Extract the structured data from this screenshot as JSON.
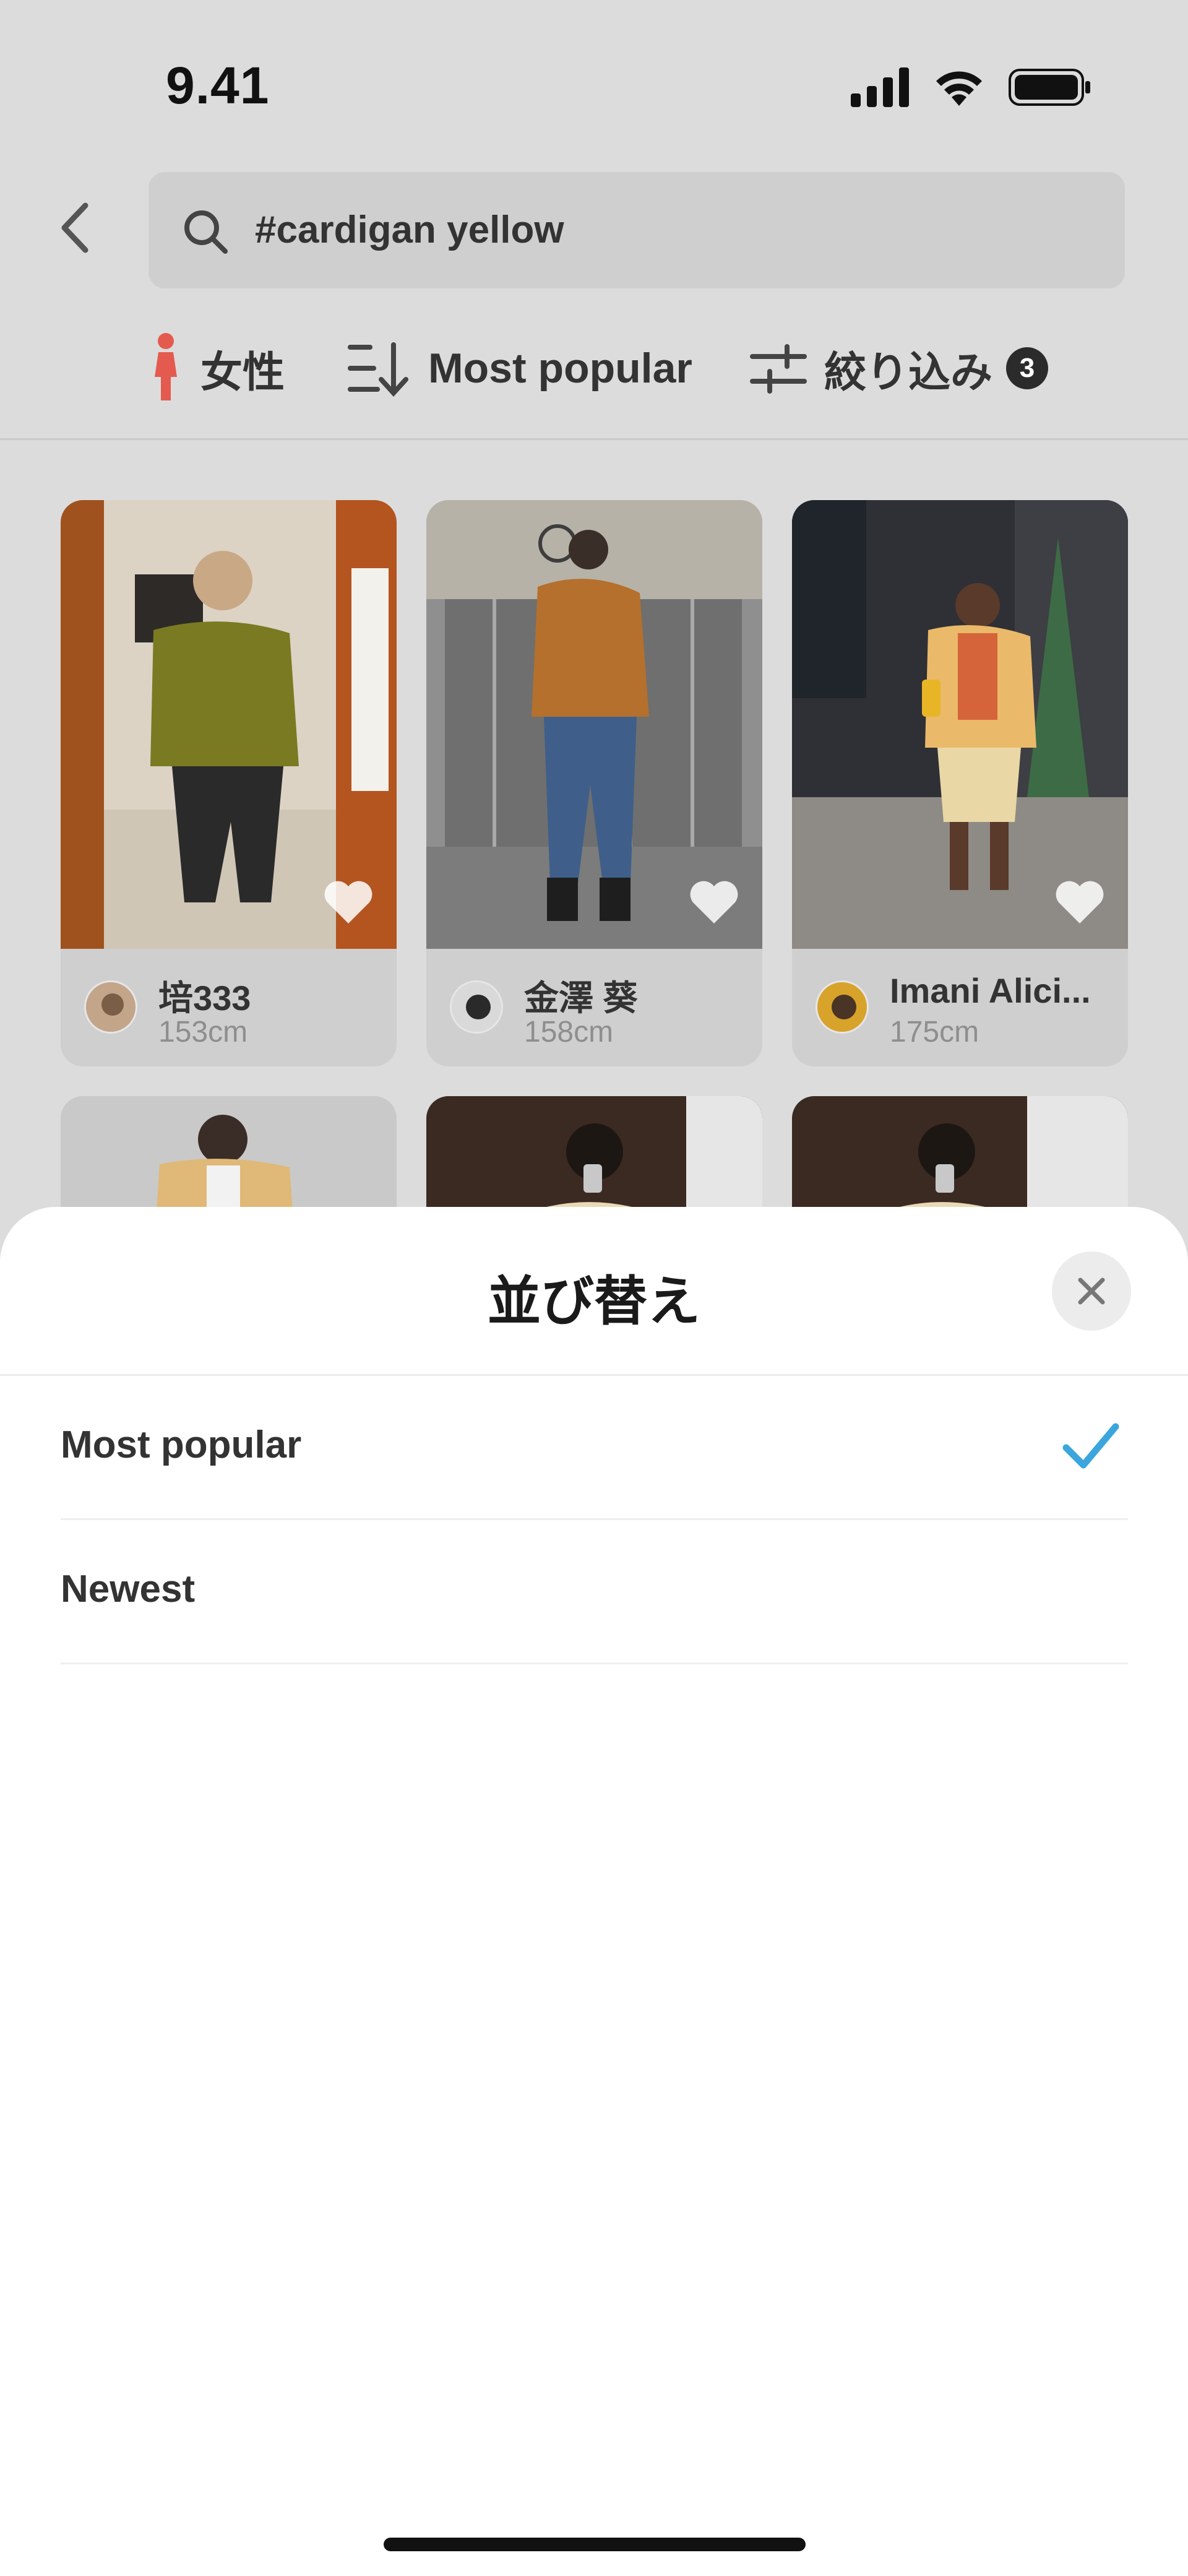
{
  "status_bar": {
    "time": "9.41"
  },
  "search": {
    "query": "#cardigan yellow"
  },
  "filters": {
    "gender_label": "女性",
    "sort_label": "Most popular",
    "refine_label": "絞り込み",
    "refine_count": "3"
  },
  "posts": [
    {
      "name": "培333",
      "height": "153cm"
    },
    {
      "name": "金澤 葵",
      "height": "158cm"
    },
    {
      "name": "Imani Alici...",
      "height": "175cm"
    }
  ],
  "sort_sheet": {
    "title": "並び替え",
    "options": [
      {
        "label": "Most popular",
        "selected": true
      },
      {
        "label": "Newest",
        "selected": false
      }
    ]
  },
  "colors": {
    "accent_check": "#3aa6dd",
    "gender_icon": "#e55a4e"
  }
}
